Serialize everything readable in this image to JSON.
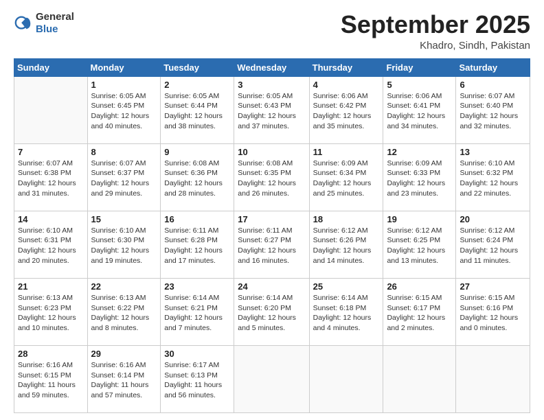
{
  "header": {
    "logo_general": "General",
    "logo_blue": "Blue",
    "month_title": "September 2025",
    "location": "Khadro, Sindh, Pakistan"
  },
  "days_of_week": [
    "Sunday",
    "Monday",
    "Tuesday",
    "Wednesday",
    "Thursday",
    "Friday",
    "Saturday"
  ],
  "weeks": [
    [
      {
        "day": "",
        "info": ""
      },
      {
        "day": "1",
        "info": "Sunrise: 6:05 AM\nSunset: 6:45 PM\nDaylight: 12 hours\nand 40 minutes."
      },
      {
        "day": "2",
        "info": "Sunrise: 6:05 AM\nSunset: 6:44 PM\nDaylight: 12 hours\nand 38 minutes."
      },
      {
        "day": "3",
        "info": "Sunrise: 6:05 AM\nSunset: 6:43 PM\nDaylight: 12 hours\nand 37 minutes."
      },
      {
        "day": "4",
        "info": "Sunrise: 6:06 AM\nSunset: 6:42 PM\nDaylight: 12 hours\nand 35 minutes."
      },
      {
        "day": "5",
        "info": "Sunrise: 6:06 AM\nSunset: 6:41 PM\nDaylight: 12 hours\nand 34 minutes."
      },
      {
        "day": "6",
        "info": "Sunrise: 6:07 AM\nSunset: 6:40 PM\nDaylight: 12 hours\nand 32 minutes."
      }
    ],
    [
      {
        "day": "7",
        "info": "Sunrise: 6:07 AM\nSunset: 6:38 PM\nDaylight: 12 hours\nand 31 minutes."
      },
      {
        "day": "8",
        "info": "Sunrise: 6:07 AM\nSunset: 6:37 PM\nDaylight: 12 hours\nand 29 minutes."
      },
      {
        "day": "9",
        "info": "Sunrise: 6:08 AM\nSunset: 6:36 PM\nDaylight: 12 hours\nand 28 minutes."
      },
      {
        "day": "10",
        "info": "Sunrise: 6:08 AM\nSunset: 6:35 PM\nDaylight: 12 hours\nand 26 minutes."
      },
      {
        "day": "11",
        "info": "Sunrise: 6:09 AM\nSunset: 6:34 PM\nDaylight: 12 hours\nand 25 minutes."
      },
      {
        "day": "12",
        "info": "Sunrise: 6:09 AM\nSunset: 6:33 PM\nDaylight: 12 hours\nand 23 minutes."
      },
      {
        "day": "13",
        "info": "Sunrise: 6:10 AM\nSunset: 6:32 PM\nDaylight: 12 hours\nand 22 minutes."
      }
    ],
    [
      {
        "day": "14",
        "info": "Sunrise: 6:10 AM\nSunset: 6:31 PM\nDaylight: 12 hours\nand 20 minutes."
      },
      {
        "day": "15",
        "info": "Sunrise: 6:10 AM\nSunset: 6:30 PM\nDaylight: 12 hours\nand 19 minutes."
      },
      {
        "day": "16",
        "info": "Sunrise: 6:11 AM\nSunset: 6:28 PM\nDaylight: 12 hours\nand 17 minutes."
      },
      {
        "day": "17",
        "info": "Sunrise: 6:11 AM\nSunset: 6:27 PM\nDaylight: 12 hours\nand 16 minutes."
      },
      {
        "day": "18",
        "info": "Sunrise: 6:12 AM\nSunset: 6:26 PM\nDaylight: 12 hours\nand 14 minutes."
      },
      {
        "day": "19",
        "info": "Sunrise: 6:12 AM\nSunset: 6:25 PM\nDaylight: 12 hours\nand 13 minutes."
      },
      {
        "day": "20",
        "info": "Sunrise: 6:12 AM\nSunset: 6:24 PM\nDaylight: 12 hours\nand 11 minutes."
      }
    ],
    [
      {
        "day": "21",
        "info": "Sunrise: 6:13 AM\nSunset: 6:23 PM\nDaylight: 12 hours\nand 10 minutes."
      },
      {
        "day": "22",
        "info": "Sunrise: 6:13 AM\nSunset: 6:22 PM\nDaylight: 12 hours\nand 8 minutes."
      },
      {
        "day": "23",
        "info": "Sunrise: 6:14 AM\nSunset: 6:21 PM\nDaylight: 12 hours\nand 7 minutes."
      },
      {
        "day": "24",
        "info": "Sunrise: 6:14 AM\nSunset: 6:20 PM\nDaylight: 12 hours\nand 5 minutes."
      },
      {
        "day": "25",
        "info": "Sunrise: 6:14 AM\nSunset: 6:18 PM\nDaylight: 12 hours\nand 4 minutes."
      },
      {
        "day": "26",
        "info": "Sunrise: 6:15 AM\nSunset: 6:17 PM\nDaylight: 12 hours\nand 2 minutes."
      },
      {
        "day": "27",
        "info": "Sunrise: 6:15 AM\nSunset: 6:16 PM\nDaylight: 12 hours\nand 0 minutes."
      }
    ],
    [
      {
        "day": "28",
        "info": "Sunrise: 6:16 AM\nSunset: 6:15 PM\nDaylight: 11 hours\nand 59 minutes."
      },
      {
        "day": "29",
        "info": "Sunrise: 6:16 AM\nSunset: 6:14 PM\nDaylight: 11 hours\nand 57 minutes."
      },
      {
        "day": "30",
        "info": "Sunrise: 6:17 AM\nSunset: 6:13 PM\nDaylight: 11 hours\nand 56 minutes."
      },
      {
        "day": "",
        "info": ""
      },
      {
        "day": "",
        "info": ""
      },
      {
        "day": "",
        "info": ""
      },
      {
        "day": "",
        "info": ""
      }
    ]
  ]
}
